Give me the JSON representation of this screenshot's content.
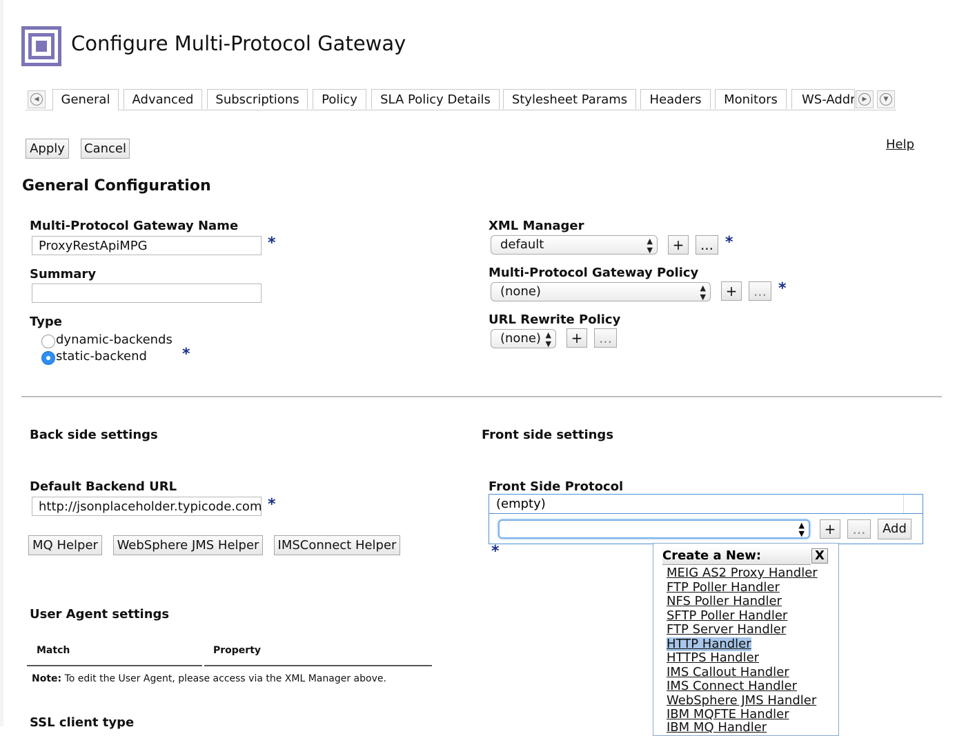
{
  "page": {
    "title": "Configure Multi-Protocol Gateway"
  },
  "tabs": [
    "General",
    "Advanced",
    "Subscriptions",
    "Policy",
    "SLA Policy Details",
    "Stylesheet Params",
    "Headers",
    "Monitors",
    "WS-Addr"
  ],
  "active_tab": "General",
  "toolbar": {
    "apply": "Apply",
    "cancel": "Cancel",
    "help": "Help"
  },
  "general": {
    "title": "General Configuration",
    "name_label": "Multi-Protocol Gateway Name",
    "name_value": "ProxyRestApiMPG",
    "summary_label": "Summary",
    "summary_value": "",
    "type_label": "Type",
    "type_options": [
      "dynamic-backends",
      "static-backend"
    ],
    "type_selected": "static-backend",
    "xml_manager_label": "XML Manager",
    "xml_manager_value": "default",
    "mpg_policy_label": "Multi-Protocol Gateway Policy",
    "mpg_policy_value": "(none)",
    "url_rewrite_label": "URL Rewrite Policy",
    "url_rewrite_value": "(none)",
    "plus": "+",
    "ellipsis": "...",
    "required": "*"
  },
  "back_side": {
    "title": "Back side settings",
    "backend_url_label": "Default Backend URL",
    "backend_url_value": "http://jsonplaceholder.typicode.com",
    "helpers": [
      "MQ Helper",
      "WebSphere JMS Helper",
      "IMSConnect Helper"
    ]
  },
  "front_side": {
    "title": "Front side settings",
    "protocol_label": "Front Side Protocol",
    "protocol_list_value": "(empty)",
    "select_value": "",
    "add_button": "Add"
  },
  "user_agent": {
    "title": "User Agent settings",
    "columns": [
      "Match",
      "Property"
    ],
    "note_bold": "Note:",
    "note_text": " To edit the User Agent, please access via the XML Manager above."
  },
  "ssl": {
    "title": "SSL client type"
  },
  "create_popup": {
    "title": "Create a New:",
    "close": "X",
    "items": [
      "MEIG AS2 Proxy Handler",
      "FTP Poller Handler",
      "NFS Poller Handler",
      "SFTP Poller Handler",
      "FTP Server Handler",
      "HTTP Handler",
      "HTTPS Handler",
      "IMS Callout Handler",
      "IMS Connect Handler",
      "WebSphere JMS Handler",
      "IBM MQFTE Handler",
      "IBM MQ Handler"
    ],
    "highlighted": "HTTP Handler"
  }
}
